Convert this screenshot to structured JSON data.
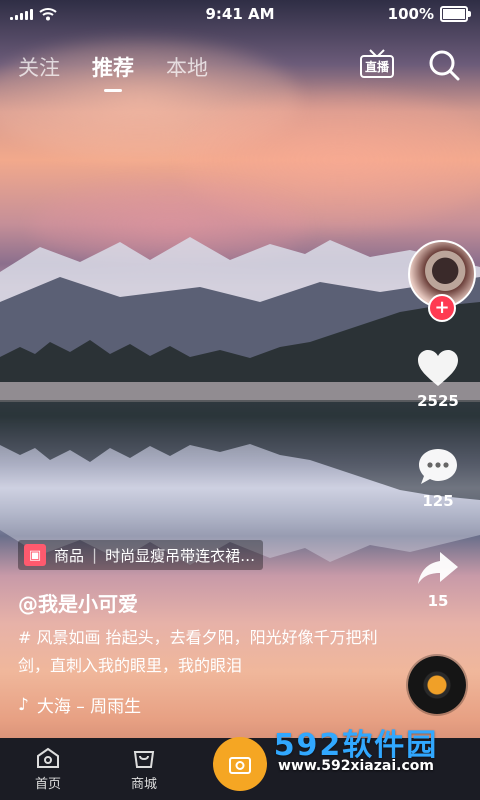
{
  "status": {
    "time": "9:41 AM",
    "battery": "100%"
  },
  "topnav": {
    "tabs": [
      "关注",
      "推荐",
      "本地"
    ],
    "live_label": "直播"
  },
  "rail": {
    "likes": "2525",
    "comments": "125",
    "shares": "15",
    "follow": "+"
  },
  "product": {
    "tag": "商品",
    "title": "时尚显瘦吊带连衣裙…"
  },
  "post": {
    "username": "@我是小可爱",
    "caption": "# 风景如画  抬起头，去看夕阳，阳光好像千万把利剑，直刺入我的眼里，我的眼泪",
    "music": "大海 – 周雨生"
  },
  "bottom": {
    "home": "首页",
    "mall": "商城"
  },
  "watermark": {
    "brand": "592软件园",
    "url": "www.592xiazai.com"
  },
  "colors": {
    "like_red": "#ff3b52",
    "accent": "#f5a623",
    "watermark_blue": "#31a8ff"
  }
}
